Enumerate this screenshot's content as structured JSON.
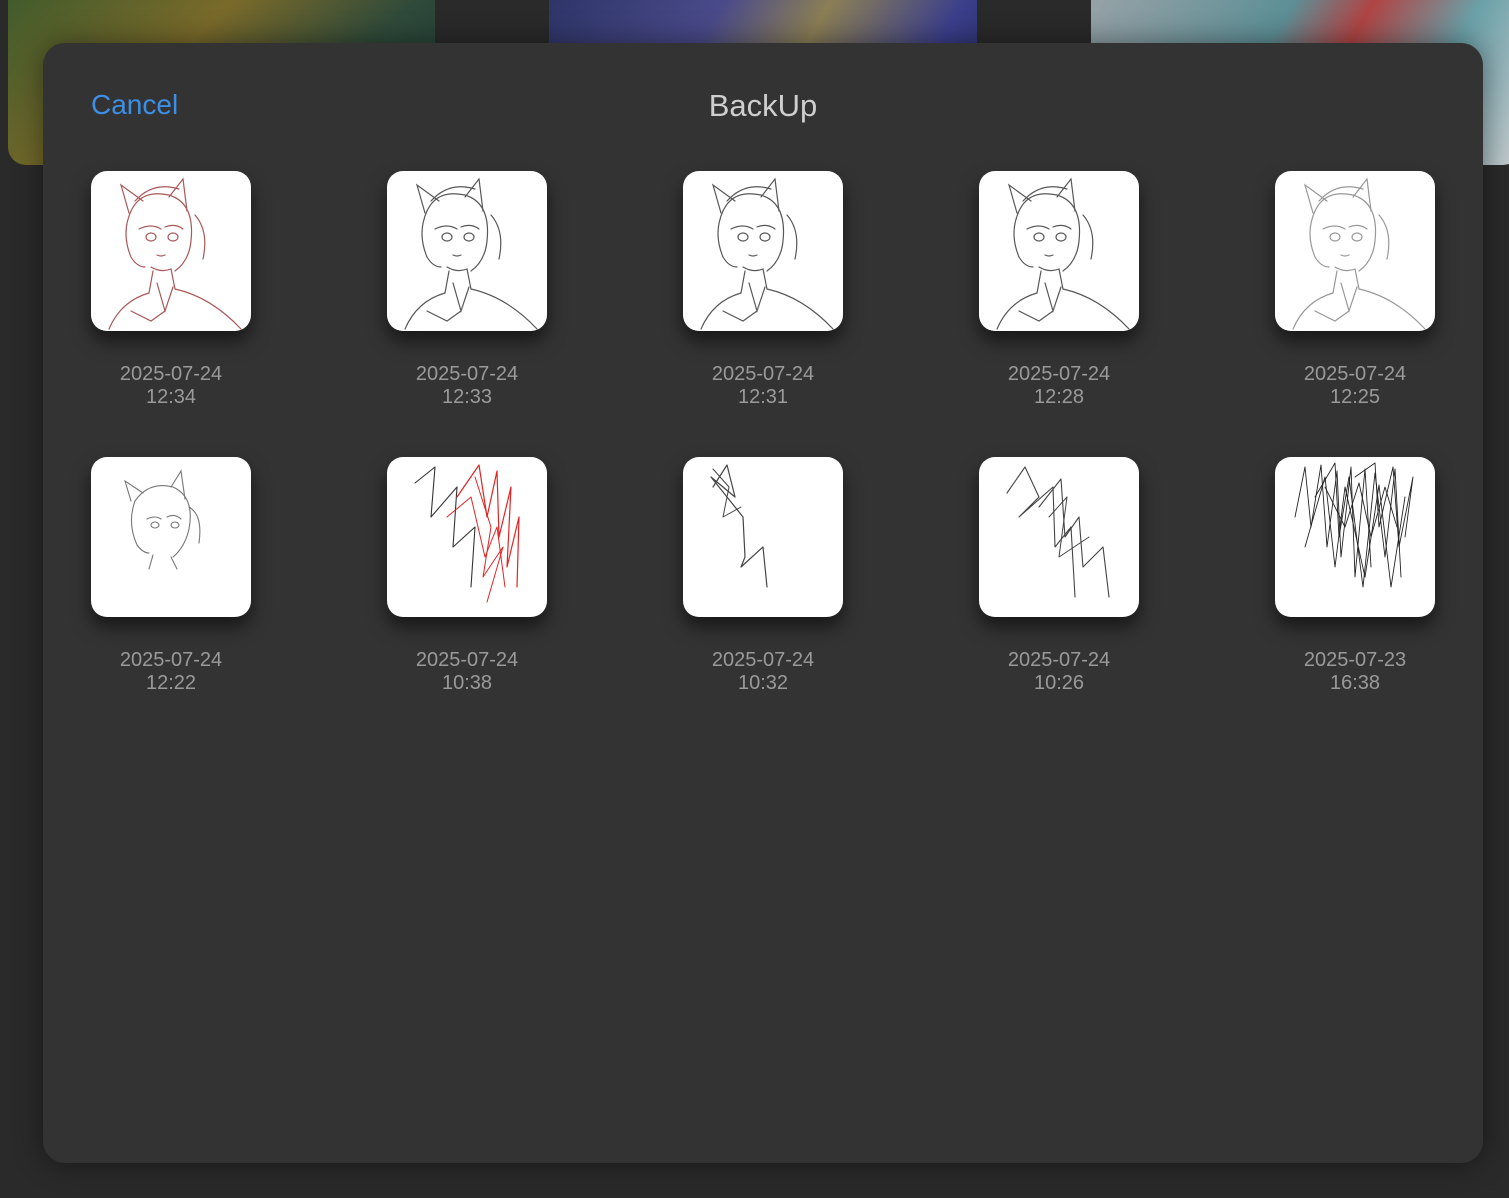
{
  "dialog": {
    "title": "BackUp",
    "cancel_label": "Cancel"
  },
  "backups": [
    {
      "date": "2025-07-24",
      "time": "12:34",
      "thumbnail": "red-sketch-portrait"
    },
    {
      "date": "2025-07-24",
      "time": "12:33",
      "thumbnail": "gray-sketch-portrait"
    },
    {
      "date": "2025-07-24",
      "time": "12:31",
      "thumbnail": "gray-sketch-portrait"
    },
    {
      "date": "2025-07-24",
      "time": "12:28",
      "thumbnail": "gray-sketch-portrait"
    },
    {
      "date": "2025-07-24",
      "time": "12:25",
      "thumbnail": "light-sketch-portrait"
    },
    {
      "date": "2025-07-24",
      "time": "12:22",
      "thumbnail": "small-sketch-head"
    },
    {
      "date": "2025-07-24",
      "time": "10:38",
      "thumbnail": "red-black-scribble"
    },
    {
      "date": "2025-07-24",
      "time": "10:32",
      "thumbnail": "single-zigzag-scribble"
    },
    {
      "date": "2025-07-24",
      "time": "10:26",
      "thumbnail": "double-zigzag-scribble"
    },
    {
      "date": "2025-07-23",
      "time": "16:38",
      "thumbnail": "dense-black-scribble"
    }
  ],
  "colors": {
    "accent": "#3d8fe6",
    "modal_bg": "#333333",
    "stamp_text": "#9a9a9a",
    "title_text": "#cfcfcf"
  }
}
